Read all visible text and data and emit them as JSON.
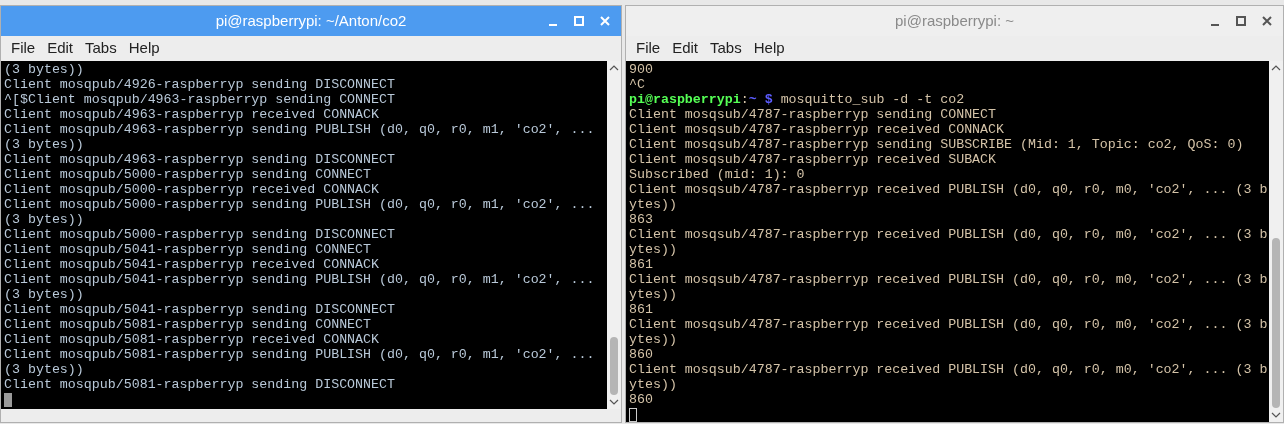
{
  "windows": [
    {
      "title": "pi@raspberrypi: ~/Anton/co2",
      "active": true,
      "menu": [
        "File",
        "Edit",
        "Tabs",
        "Help"
      ],
      "lines": [
        {
          "text": "(3 bytes))"
        },
        {
          "text": "Client mosqpub/4926-raspberryp sending DISCONNECT"
        },
        {
          "text": "^[$Client mosqpub/4963-raspberryp sending CONNECT"
        },
        {
          "text": "Client mosqpub/4963-raspberryp received CONNACK"
        },
        {
          "text": "Client mosqpub/4963-raspberryp sending PUBLISH (d0, q0, r0, m1, 'co2', ..."
        },
        {
          "text": "(3 bytes))"
        },
        {
          "text": "Client mosqpub/4963-raspberryp sending DISCONNECT"
        },
        {
          "text": "Client mosqpub/5000-raspberryp sending CONNECT"
        },
        {
          "text": "Client mosqpub/5000-raspberryp received CONNACK"
        },
        {
          "text": "Client mosqpub/5000-raspberryp sending PUBLISH (d0, q0, r0, m1, 'co2', ..."
        },
        {
          "text": "(3 bytes))"
        },
        {
          "text": "Client mosqpub/5000-raspberryp sending DISCONNECT"
        },
        {
          "text": "Client mosqpub/5041-raspberryp sending CONNECT"
        },
        {
          "text": "Client mosqpub/5041-raspberryp received CONNACK"
        },
        {
          "text": "Client mosqpub/5041-raspberryp sending PUBLISH (d0, q0, r0, m1, 'co2', ..."
        },
        {
          "text": "(3 bytes))"
        },
        {
          "text": "Client mosqpub/5041-raspberryp sending DISCONNECT"
        },
        {
          "text": "Client mosqpub/5081-raspberryp sending CONNECT"
        },
        {
          "text": "Client mosqpub/5081-raspberryp received CONNACK"
        },
        {
          "text": "Client mosqpub/5081-raspberryp sending PUBLISH (d0, q0, r0, m1, 'co2', ..."
        },
        {
          "text": "(3 bytes))"
        },
        {
          "text": "Client mosqpub/5081-raspberryp sending DISCONNECT"
        }
      ]
    },
    {
      "title": "pi@raspberrypi: ~",
      "active": false,
      "menu": [
        "File",
        "Edit",
        "Tabs",
        "Help"
      ],
      "lines": [
        {
          "text": "900"
        },
        {
          "text": "^C"
        },
        {
          "segments": [
            {
              "text": "pi@raspberrypi",
              "kind": "user"
            },
            {
              "text": ":",
              "kind": "plain"
            },
            {
              "text": "~ $",
              "kind": "path"
            },
            {
              "text": " mosquitto_sub -d -t co2",
              "kind": "plain"
            }
          ]
        },
        {
          "text": "Client mosqsub/4787-raspberryp sending CONNECT"
        },
        {
          "text": "Client mosqsub/4787-raspberryp received CONNACK"
        },
        {
          "text": "Client mosqsub/4787-raspberryp sending SUBSCRIBE (Mid: 1, Topic: co2, QoS: 0)"
        },
        {
          "text": "Client mosqsub/4787-raspberryp received SUBACK"
        },
        {
          "text": "Subscribed (mid: 1): 0"
        },
        {
          "text": "Client mosqsub/4787-raspberryp received PUBLISH (d0, q0, r0, m0, 'co2', ... (3 b"
        },
        {
          "text": "ytes))"
        },
        {
          "text": "863"
        },
        {
          "text": "Client mosqsub/4787-raspberryp received PUBLISH (d0, q0, r0, m0, 'co2', ... (3 b"
        },
        {
          "text": "ytes))"
        },
        {
          "text": "861"
        },
        {
          "text": "Client mosqsub/4787-raspberryp received PUBLISH (d0, q0, r0, m0, 'co2', ... (3 b"
        },
        {
          "text": "ytes))"
        },
        {
          "text": "861"
        },
        {
          "text": "Client mosqsub/4787-raspberryp received PUBLISH (d0, q0, r0, m0, 'co2', ... (3 b"
        },
        {
          "text": "ytes))"
        },
        {
          "text": "860"
        },
        {
          "text": "Client mosqsub/4787-raspberryp received PUBLISH (d0, q0, r0, m0, 'co2', ... (3 b"
        },
        {
          "text": "ytes))"
        },
        {
          "text": "860"
        }
      ]
    }
  ]
}
